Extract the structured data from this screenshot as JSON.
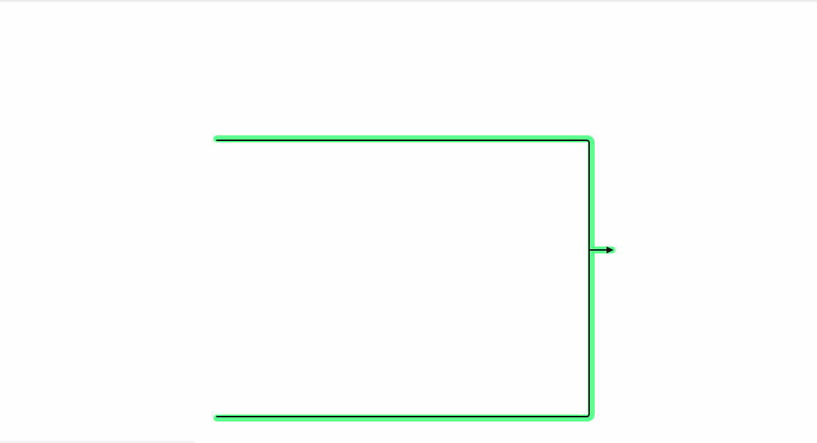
{
  "diagram": {
    "colors": {
      "background": "#fdfdfd",
      "highlight": "#5bff8e",
      "connector": "#000000"
    },
    "connector": {
      "kind": "bracket-merge-connector",
      "selected": true,
      "inputs": 2,
      "outputs": 1,
      "arrowhead": "triangle-right"
    }
  }
}
